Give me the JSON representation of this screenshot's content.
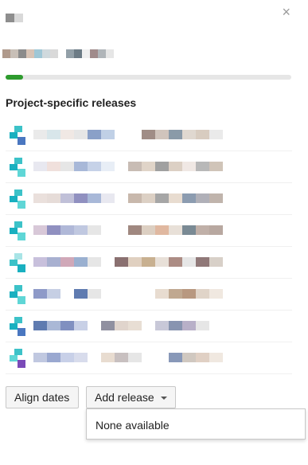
{
  "close_label": "×",
  "heading_blur_colors": [
    "#8e8e8e",
    "#d9d9d9"
  ],
  "subline_blur_colors": [
    "#b09a8c",
    "#c8bfb7",
    "#8b8b8b",
    "#d7c3b5",
    "#9fc7d6",
    "#cfd9dd",
    "#d9d9d9",
    "#ffffff",
    "#93a0a8",
    "#6d7c86",
    "#f0f0f0",
    "#a08b8b",
    "#b0b5b9",
    "#e6e6e6"
  ],
  "progress": {
    "fraction": 0.06,
    "color": "#2e9b2e"
  },
  "section_title": "Project-specific releases",
  "rows": [
    {
      "icon": "teal-blue",
      "colors": [
        "#eaeaea",
        "#d8e6ea",
        "#f0e8e4",
        "#e6e6e6",
        "#8aa0c8",
        "#c0d0e6",
        "#ffffff",
        "#ffffff",
        "#a08d86",
        "#d0c4bc",
        "#8a9aa8",
        "#e0d8d0",
        "#d8ccc0",
        "#eaeaea"
      ]
    },
    {
      "icon": "teal",
      "colors": [
        "#e8e8f0",
        "#f0e0dc",
        "#e6e6e6",
        "#a8b8d8",
        "#c6d2e8",
        "#e8eef6",
        "#ffffff",
        "#c8bcb4",
        "#e0d4c8",
        "#a0a0a0",
        "#dcd0c4",
        "#f0e8e4",
        "#b8b8b8",
        "#d0c4b8"
      ]
    },
    {
      "icon": "teal",
      "colors": [
        "#eae0dc",
        "#e6dcd8",
        "#c0c0d8",
        "#9090c0",
        "#a8b8d8",
        "#e8e8f0",
        "#ffffff",
        "#c8b8ac",
        "#dcd0c4",
        "#a6a6a6",
        "#e8dcd0",
        "#8c9cb0",
        "#b0b0b8",
        "#c0b4ac"
      ]
    },
    {
      "icon": "teal",
      "colors": [
        "#d8c8d8",
        "#9090c0",
        "#b0b8d8",
        "#c0c8e0",
        "#e6e6e6",
        "#ffffff",
        "#ffffff",
        "#a08880",
        "#dccfc2",
        "#e0b8a0",
        "#e8e0d8",
        "#7a8a94",
        "#c0b0a8",
        "#b8a8a0"
      ]
    },
    {
      "icon": "teal-light",
      "colors": [
        "#c8c0dc",
        "#a8b0d0",
        "#d0a8b8",
        "#9ab0d0",
        "#e6e6e6",
        "#ffffff",
        "#8a7070",
        "#e0d0c0",
        "#c8b090",
        "#e8e0d8",
        "#ac8c84",
        "#e6e6e6",
        "#907878",
        "#d8d0c8"
      ]
    },
    {
      "icon": "teal",
      "colors": [
        "#8e9ac8",
        "#c6cfe4",
        "#ffffff",
        "#5f7bb0",
        "#e6e6e6",
        "#ffffff",
        "#ffffff",
        "#ffffff",
        "#ffffff",
        "#e8dcd0",
        "#c0a890",
        "#b89880",
        "#e0d4c8",
        "#f0e8e0"
      ]
    },
    {
      "icon": "teal-blue",
      "colors": [
        "#5f7bb0",
        "#aab8d6",
        "#8090c0",
        "#c8d0e6",
        "#ffffff",
        "#9090a0",
        "#e0d4cc",
        "#e8ded4",
        "#ffffff",
        "#c8c8d8",
        "#8894b0",
        "#b8b0c8",
        "#e6e6e6",
        "#ffffff"
      ]
    },
    {
      "icon": "teal-purple",
      "colors": [
        "#c0c8e0",
        "#9aa8d0",
        "#c8d0e8",
        "#d8dcec",
        "#ffffff",
        "#e8dcd0",
        "#c8c0c0",
        "#e6e6e6",
        "#ffffff",
        "#ffffff",
        "#8898b8",
        "#d0c8c0",
        "#e0d0c4",
        "#f0e8e0"
      ]
    }
  ],
  "buttons": {
    "align_dates": "Align dates",
    "add_release": "Add release"
  },
  "dropdown": {
    "items": [
      "None available"
    ]
  }
}
